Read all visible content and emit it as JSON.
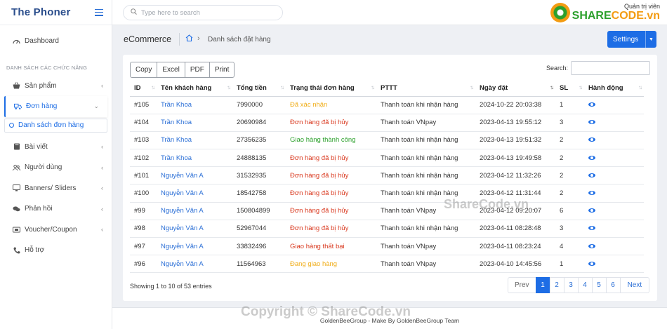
{
  "brand": {
    "title": "The Phoner"
  },
  "sidebar": {
    "dashboard": "Dashboard",
    "section": "DANH SÁCH CÁC CHỨC NĂNG",
    "items": [
      {
        "label": "Sản phẩm",
        "icon": "basket-icon"
      },
      {
        "label": "Đơn hàng",
        "icon": "delivery-icon"
      },
      {
        "label": "Bài viết",
        "icon": "book-icon"
      },
      {
        "label": "Người dùng",
        "icon": "users-icon"
      },
      {
        "label": "Banners/ Sliders",
        "icon": "monitor-icon"
      },
      {
        "label": "Phản hồi",
        "icon": "comments-icon"
      },
      {
        "label": "Voucher/Coupon",
        "icon": "ticket-icon"
      },
      {
        "label": "Hỗ trợ",
        "icon": "phone-icon"
      }
    ],
    "sub_active": "Danh sách đơn hàng"
  },
  "topbar": {
    "search_placeholder": "Type here to search",
    "logo_line1": "Quản trị viên",
    "logo_share": "SHARE",
    "logo_code": "CODE.vn"
  },
  "breadcrumb": {
    "title": "eCommerce",
    "current": "Danh sách đặt hàng"
  },
  "settings_label": "Settings",
  "export_buttons": [
    "Copy",
    "Excel",
    "PDF",
    "Print"
  ],
  "table_search_label": "Search:",
  "columns": [
    "ID",
    "Tên khách hàng",
    "Tổng tiền",
    "Trạng thái đơn hàng",
    "PTTT",
    "Ngày đặt",
    "SL",
    "Hành động"
  ],
  "rows": [
    {
      "id": "#105",
      "customer": "Trần Khoa",
      "total": "7990000",
      "status": "Đã xác nhận",
      "status_color": "#f0ad18",
      "payment": "Thanh toán khi nhận hàng",
      "date": "2024-10-22 20:03:38",
      "qty": "1"
    },
    {
      "id": "#104",
      "customer": "Trần Khoa",
      "total": "20690984",
      "status": "Đơn hàng đã bị hủy",
      "status_color": "#d9381e",
      "payment": "Thanh toán VNpay",
      "date": "2023-04-13 19:55:12",
      "qty": "3"
    },
    {
      "id": "#103",
      "customer": "Trần Khoa",
      "total": "27356235",
      "status": "Giao hàng thành công",
      "status_color": "#2ca02c",
      "payment": "Thanh toán khi nhận hàng",
      "date": "2023-04-13 19:51:32",
      "qty": "2"
    },
    {
      "id": "#102",
      "customer": "Trần Khoa",
      "total": "24888135",
      "status": "Đơn hàng đã bị hủy",
      "status_color": "#d9381e",
      "payment": "Thanh toán khi nhận hàng",
      "date": "2023-04-13 19:49:58",
      "qty": "2"
    },
    {
      "id": "#101",
      "customer": "Nguyễn Văn A",
      "total": "31532935",
      "status": "Đơn hàng đã bị hủy",
      "status_color": "#d9381e",
      "payment": "Thanh toán khi nhận hàng",
      "date": "2023-04-12 11:32:26",
      "qty": "2"
    },
    {
      "id": "#100",
      "customer": "Nguyễn Văn A",
      "total": "18542758",
      "status": "Đơn hàng đã bị hủy",
      "status_color": "#d9381e",
      "payment": "Thanh toán khi nhận hàng",
      "date": "2023-04-12 11:31:44",
      "qty": "2"
    },
    {
      "id": "#99",
      "customer": "Nguyễn Văn A",
      "total": "150804899",
      "status": "Đơn hàng đã bị hủy",
      "status_color": "#d9381e",
      "payment": "Thanh toán VNpay",
      "date": "2023-04-12 09:20:07",
      "qty": "6"
    },
    {
      "id": "#98",
      "customer": "Nguyễn Văn A",
      "total": "52967044",
      "status": "Đơn hàng đã bị hủy",
      "status_color": "#d9381e",
      "payment": "Thanh toán khi nhận hàng",
      "date": "2023-04-11 08:28:48",
      "qty": "3"
    },
    {
      "id": "#97",
      "customer": "Nguyễn Văn A",
      "total": "33832496",
      "status": "Giao hàng thất bại",
      "status_color": "#d9381e",
      "payment": "Thanh toán VNpay",
      "date": "2023-04-11 08:23:24",
      "qty": "4"
    },
    {
      "id": "#96",
      "customer": "Nguyễn Văn A",
      "total": "11564963",
      "status": "Đang giao hàng",
      "status_color": "#f0ad18",
      "payment": "Thanh toán VNpay",
      "date": "2023-04-10 14:45:56",
      "qty": "1"
    }
  ],
  "table_info": "Showing 1 to 10 of 53 entries",
  "pagination": {
    "prev": "Prev",
    "pages": [
      "1",
      "2",
      "3",
      "4",
      "5",
      "6"
    ],
    "current": "1",
    "next": "Next"
  },
  "footer": "GoldenBeeGroup - Make By GoldenBeeGroup Team",
  "watermarks": {
    "center": "ShareCode.vn",
    "bottom": "Copyright © ShareCode.vn"
  }
}
